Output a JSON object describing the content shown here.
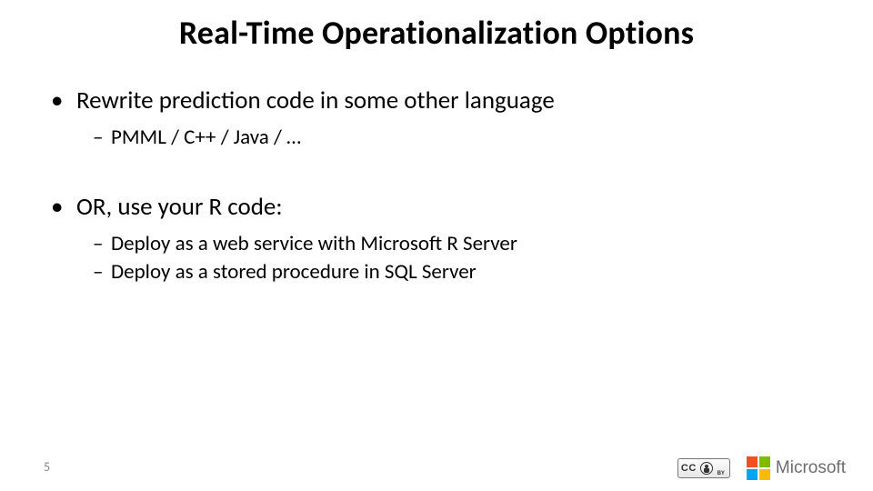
{
  "title": "Real-Time Operationalization Options",
  "bullets": [
    {
      "text": "Rewrite prediction code in some other language",
      "sub": [
        "PMML / C++ / Java / …"
      ]
    },
    {
      "text": "OR, use your R code:",
      "sub": [
        "Deploy as a web service with Microsoft R Server",
        "Deploy as a stored procedure in SQL Server"
      ]
    }
  ],
  "page_number": "5",
  "cc": {
    "label_left": "CC",
    "label_right": "BY"
  },
  "microsoft": {
    "name": "Microsoft"
  },
  "colors": {
    "ms_red": "#f25022",
    "ms_green": "#7fba00",
    "ms_blue": "#00a4ef",
    "ms_yellow": "#ffb900"
  }
}
